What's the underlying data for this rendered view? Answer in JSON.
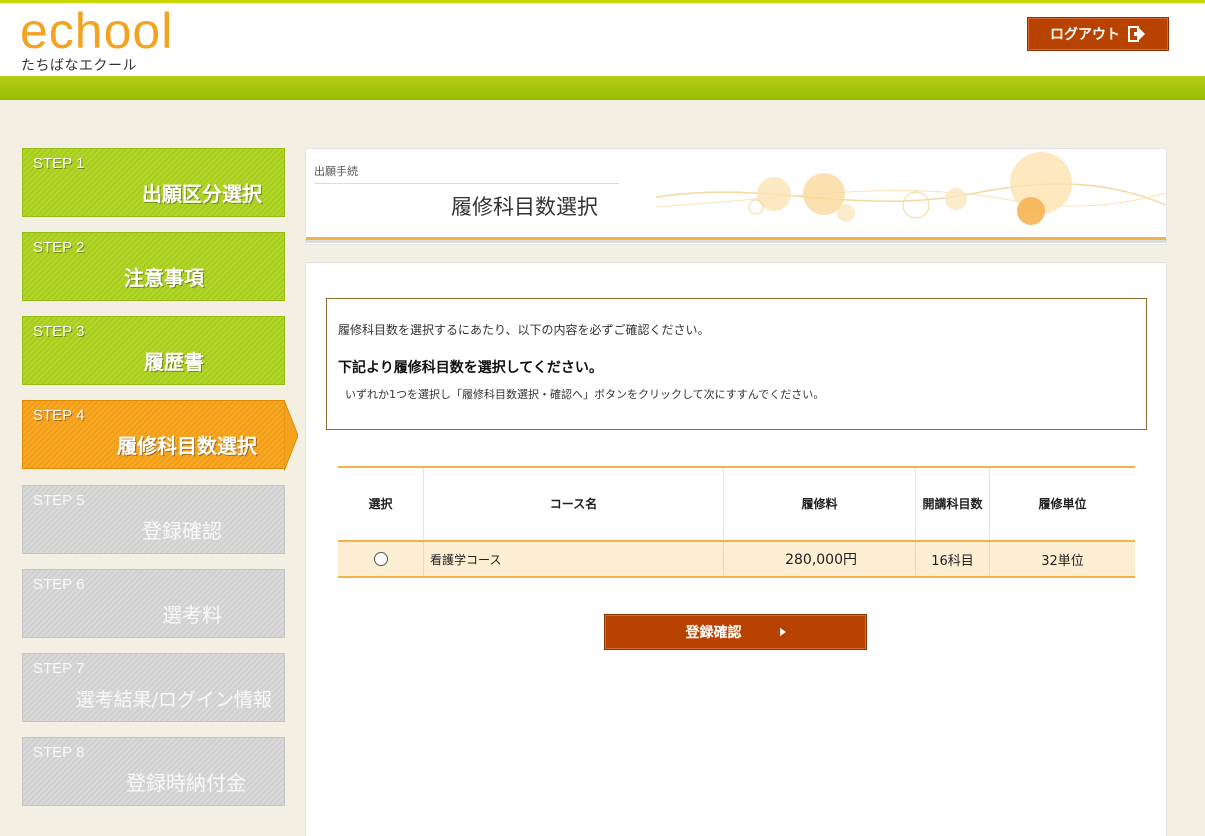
{
  "header": {
    "logo_main": "echool",
    "logo_sub": "たちばなエクール",
    "logout_label": "ログアウト"
  },
  "steps": [
    {
      "no": "STEP 1",
      "title": "出願区分選択",
      "state": "done"
    },
    {
      "no": "STEP 2",
      "title": "注意事項",
      "state": "done"
    },
    {
      "no": "STEP 3",
      "title": "履歴書",
      "state": "done"
    },
    {
      "no": "STEP 4",
      "title": "履修科目数選択",
      "state": "current"
    },
    {
      "no": "STEP 5",
      "title": "登録確認",
      "state": "todo"
    },
    {
      "no": "STEP 6",
      "title": "選考料",
      "state": "todo"
    },
    {
      "no": "STEP 7",
      "title": "選考結果/ログイン情報",
      "state": "todo"
    },
    {
      "no": "STEP 8",
      "title": "登録時納付金",
      "state": "todo"
    }
  ],
  "page": {
    "breadcrumb": "出願手続",
    "title": "履修科目数選択"
  },
  "notice": {
    "line1": "履修科目数を選択するにあたり、以下の内容を必ずご確認ください。",
    "line2": "下記より履修科目数を選択してください。",
    "line3": "いずれか1つを選択し「履修科目数選択・確認へ」ボタンをクリックして次にすすんでください。"
  },
  "table": {
    "headers": {
      "select": "選択",
      "course": "コース名",
      "fee": "履修料",
      "subjects": "開講科目数",
      "units": "履修単位"
    },
    "rows": [
      {
        "course": "看護学コース",
        "fee": "280,000円",
        "subjects": "16科目",
        "units": "32単位",
        "selected": false
      }
    ]
  },
  "actions": {
    "submit_label": "登録確認"
  },
  "colors": {
    "accent_orange": "#f39c16",
    "button_brown": "#b84200",
    "green": "#a6cc1e",
    "logo_orange": "#f2a322"
  }
}
